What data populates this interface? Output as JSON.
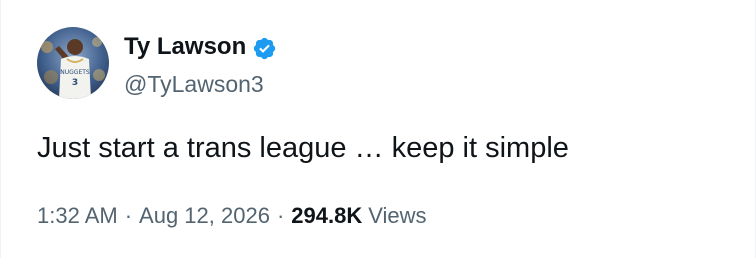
{
  "author": {
    "display_name": "Ty Lawson",
    "handle": "@TyLawson3",
    "verified": true,
    "verified_color": "#1d9bf0",
    "avatar_icon": "player-avatar"
  },
  "tweet": {
    "text": "Just start a trans league … keep it simple"
  },
  "meta": {
    "time": "1:32 AM",
    "separator": "·",
    "date": "Aug 12, 2026",
    "views_count": "294.8K",
    "views_label": "Views"
  },
  "colors": {
    "text_primary": "#0f1419",
    "text_secondary": "#536471",
    "accent": "#1d9bf0"
  }
}
